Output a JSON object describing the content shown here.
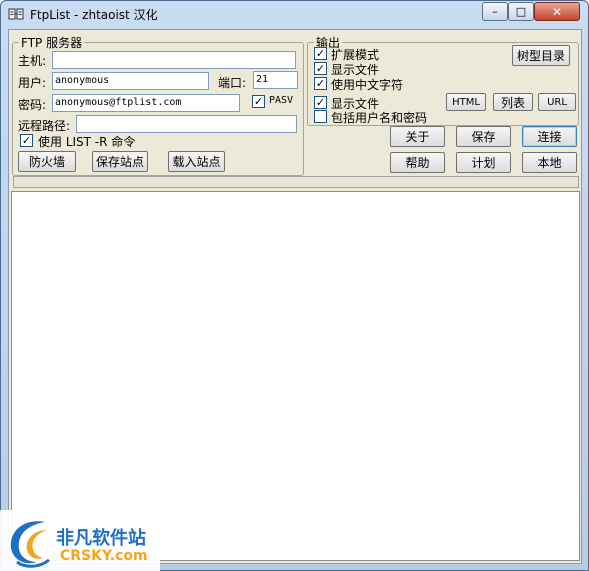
{
  "window": {
    "title": "FtpList - zhtaoist 汉化",
    "minimize_glyph": "–",
    "maximize_glyph": "□",
    "close_glyph": "✕"
  },
  "ftp_server": {
    "legend": "FTP 服务器",
    "host_label": "主机:",
    "host_value": "",
    "user_label": "用户:",
    "user_value": "anonymous",
    "port_label": "端口:",
    "port_value": "21",
    "password_label": "密码:",
    "password_value": "anonymous@ftplist.com",
    "pasv_label": "PASV",
    "pasv_checked": true,
    "remote_path_label": "远程路径:",
    "remote_path_value": "",
    "use_list_r_label": "使用 LIST -R 命令",
    "use_list_r_checked": true,
    "buttons": {
      "firewall": "防火墙",
      "save_site": "保存站点",
      "load_site": "载入站点"
    }
  },
  "output": {
    "legend": "输出",
    "extended_mode_label": "扩展模式",
    "extended_mode_checked": true,
    "show_files_label": "显示文件",
    "show_files_checked": true,
    "use_chinese_label": "使用中文字符",
    "use_chinese_checked": true,
    "show_files2_label": "显示文件",
    "show_files2_checked": true,
    "include_credentials_label": "包括用户名和密码",
    "include_credentials_checked": false,
    "tree_button": "树型目录",
    "html_button": "HTML",
    "list_button": "列表",
    "url_button": "URL"
  },
  "actions": {
    "about": "关于",
    "save": "保存",
    "connect": "连接",
    "help": "帮助",
    "schedule": "计划",
    "local": "本地"
  },
  "watermark": {
    "brand_cn": "非凡软件站",
    "brand_en": "CRSKY.com"
  },
  "colors": {
    "window_frame": "#b6cde9",
    "client_bg": "#ece9d8",
    "close_red": "#c0462f",
    "watermark_blue": "#1f6fc5"
  }
}
